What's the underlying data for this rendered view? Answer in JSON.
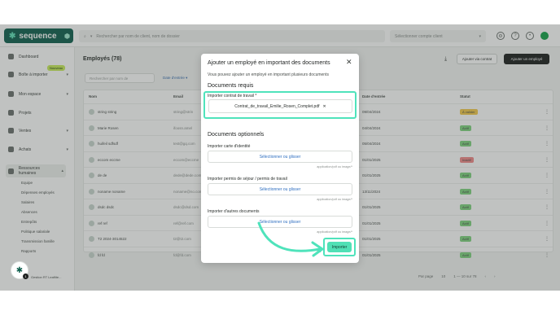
{
  "app": {
    "logo_text": "sequence",
    "search_placeholder": "Rechercher par nom de client, nom de dossier",
    "client_select": "Sélectionner compte client"
  },
  "sidebar": {
    "items": [
      {
        "label": "Dashboard"
      },
      {
        "label": "Boîte à importer",
        "badge": "Nouveau"
      },
      {
        "label": "Mon espace"
      },
      {
        "label": "Projets"
      },
      {
        "label": "Ventes"
      },
      {
        "label": "Achats"
      },
      {
        "label": "Ressources humaines"
      }
    ],
    "subitems": [
      "Equipe",
      "Dépenses employés",
      "Salaires",
      "Absences",
      "Entrepôts",
      "Politique salariale",
      "Transmission famille",
      "Rapports"
    ],
    "user": "Gestion RT Leaflite..."
  },
  "main": {
    "title": "Employés (78)",
    "export_label": "Ajouter via contrat",
    "add_label": "Ajouter un employé",
    "table_search": "Rechercher par nom de",
    "filter_label": "Date d'entrée",
    "columns": [
      "Nom",
      "Email",
      "Date d'entrée",
      "Statut"
    ],
    "rows": [
      {
        "name": "string string",
        "email": "string@strin",
        "date": "09/04/2024",
        "status": "À valider",
        "status_color": "#f2c94c"
      },
      {
        "name": "Marie Rosen",
        "email": "ifoosn.amel",
        "date": "04/04/2024",
        "status": "Actif",
        "status_color": "#7fd37f"
      },
      {
        "name": "huifeil sdfsdf",
        "email": "test@gq.com",
        "date": "05/04/2024",
        "status": "Actif",
        "status_color": "#7fd37f"
      },
      {
        "name": "eccom eccme",
        "email": "eccom@eccme",
        "date": "01/01/2025",
        "status": "Inactif",
        "status_color": "#f08a8a"
      },
      {
        "name": "de de",
        "email": "dede@dede.com",
        "date": "01/01/2025",
        "status": "Actif",
        "status_color": "#7fd37f"
      },
      {
        "name": "noname noname",
        "email": "noname@no.com",
        "date": "13/11/2024",
        "status": "Actif",
        "status_color": "#7fd37f"
      },
      {
        "name": "dsdc dsdc",
        "email": "dsdc@dsd.com",
        "date": "01/01/2025",
        "status": "Actif",
        "status_color": "#7fd37f"
      },
      {
        "name": "ref ref",
        "email": "ref@ref.com",
        "date": "01/01/2025",
        "status": "Actif",
        "status_color": "#7fd37f"
      },
      {
        "name": "T2 2024-3014522",
        "email": "t2@t2.com",
        "date": "01/01/2025",
        "status": "Actif",
        "status_color": "#7fd37f"
      },
      {
        "name": "fd fd",
        "email": "fd@fd.com",
        "date": "01/01/2025",
        "status": "Actif",
        "status_color": "#7fd37f"
      }
    ],
    "pager": {
      "per_page_label": "Par page",
      "per_page": "10",
      "range": "1 — 10 sur 78"
    }
  },
  "modal": {
    "title": "Ajouter un employé en important des documents",
    "description": "Vous pouvez ajouter un employé en important plusieurs documents",
    "required_heading": "Documents requis",
    "contract_label": "Importer contrat de travail *",
    "contract_file": "Contrat_de_travail_Emilie_Rosen_Complet.pdf",
    "optional_heading": "Documents optionnels",
    "id_label": "Importer carte d'identité",
    "permit_label": "Importer permis de séjour / permis de travail",
    "other_label": "Importer d'autres documents",
    "drop_text": "Sélectionner ou glisser",
    "hint": "application/pdf ou image/*",
    "cancel_label": "Annuler",
    "import_label": "Importer"
  },
  "colors": {
    "highlight": "#4fe3bb",
    "brand": "#0f5f4e",
    "accent_button": "#50e0b5"
  }
}
